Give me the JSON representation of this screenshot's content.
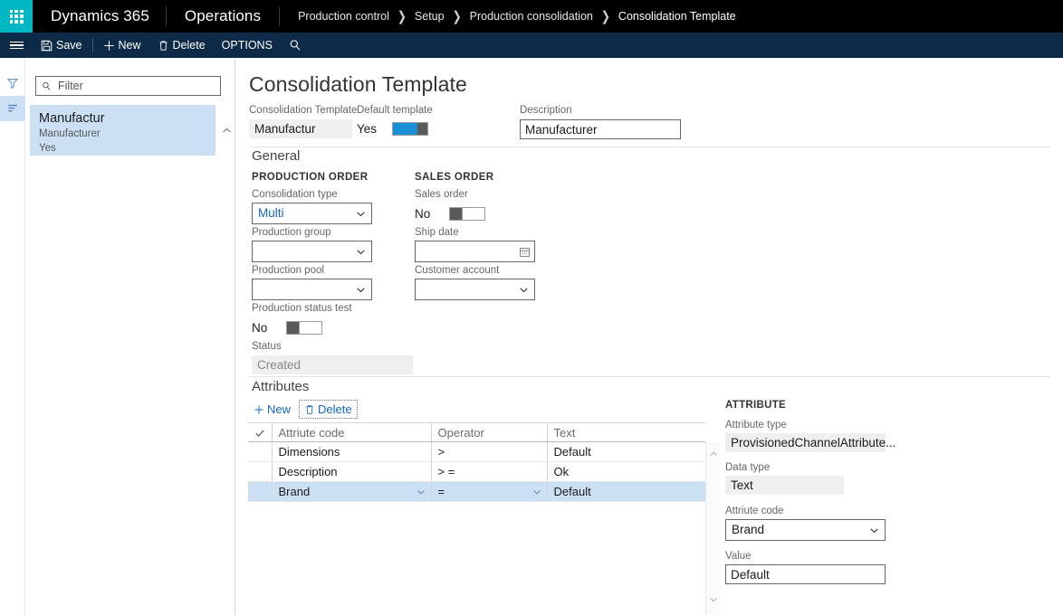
{
  "topbar": {
    "waffle_icon": "waffle-grid-icon",
    "brand": "Dynamics 365",
    "module": "Operations",
    "breadcrumb": [
      "Production control",
      "Setup",
      "Production consolidation",
      "Consolidation Template"
    ]
  },
  "commandbar": {
    "menu_icon": "hamburger-icon",
    "save_label": "Save",
    "new_label": "New",
    "delete_label": "Delete",
    "options_label": "OPTIONS",
    "search_icon": "search-icon"
  },
  "rail": {
    "filter_icon": "filter-funnel-icon",
    "sort_icon": "sort-lines-icon"
  },
  "listpanel": {
    "filter_icon": "search-icon",
    "filter_placeholder": "Filter",
    "filter_value": "",
    "collapse_icon": "chevron-up-icon",
    "items": [
      {
        "title": "Manufactur",
        "subtitle": "Manufacturer",
        "status": "Yes"
      }
    ]
  },
  "page": {
    "title": "Consolidation Template",
    "header_fields": {
      "template_label": "Consolidation Template",
      "template_value": "Manufactur",
      "default_label": "Default template",
      "default_state_text": "Yes",
      "default_state_on": true,
      "description_label": "Description",
      "description_value": "Manufacturer"
    },
    "general": {
      "section_title": "General",
      "production_order_heading": "PRODUCTION ORDER",
      "sales_order_heading": "SALES ORDER",
      "consolidation_type_label": "Consolidation type",
      "consolidation_type_value": "Multi",
      "production_group_label": "Production group",
      "production_group_value": "",
      "production_pool_label": "Production pool",
      "production_pool_value": "",
      "production_status_test_label": "Production status test",
      "production_status_test_text": "No",
      "status_label": "Status",
      "status_value": "Created",
      "sales_order_label": "Sales order",
      "sales_order_text": "No",
      "ship_date_label": "Ship date",
      "ship_date_value": "",
      "ship_date_icon": "calendar-icon",
      "customer_account_label": "Customer account",
      "customer_account_value": ""
    },
    "attributes": {
      "section_title": "Attributes",
      "new_label": "New",
      "delete_label": "Delete",
      "new_icon": "plus-icon",
      "delete_icon": "trash-icon",
      "columns": [
        "",
        "Attriute code",
        "Operator",
        "Text"
      ],
      "check_icon": "checkmark-icon",
      "rows": [
        {
          "code": "Dimensions",
          "operator": ">",
          "text": "Default",
          "selected": false
        },
        {
          "code": "Description",
          "operator": "> =",
          "text": "Ok",
          "selected": false
        },
        {
          "code": "Brand",
          "operator": "=",
          "text": "Default",
          "selected": true
        }
      ],
      "scroll_up_icon": "chevron-up-icon",
      "scroll_down_icon": "chevron-down-icon"
    },
    "attribute_panel": {
      "heading": "ATTRIBUTE",
      "attribute_type_label": "Attribute type",
      "attribute_type_value": "ProvisionedChannelAttribute...",
      "data_type_label": "Data type",
      "data_type_value": "Text",
      "attriute_code_label": "Attriute code",
      "attriute_code_value": "Brand",
      "value_label": "Value",
      "value_value": "Default"
    }
  },
  "colors": {
    "topbar_bg": "#000000",
    "waffle_bg": "#00b7c3",
    "commandbar_bg": "#0d2b48",
    "accent_link": "#1566c0",
    "selection_bg": "#cce0f4",
    "toggle_on": "#1b8fd6"
  }
}
